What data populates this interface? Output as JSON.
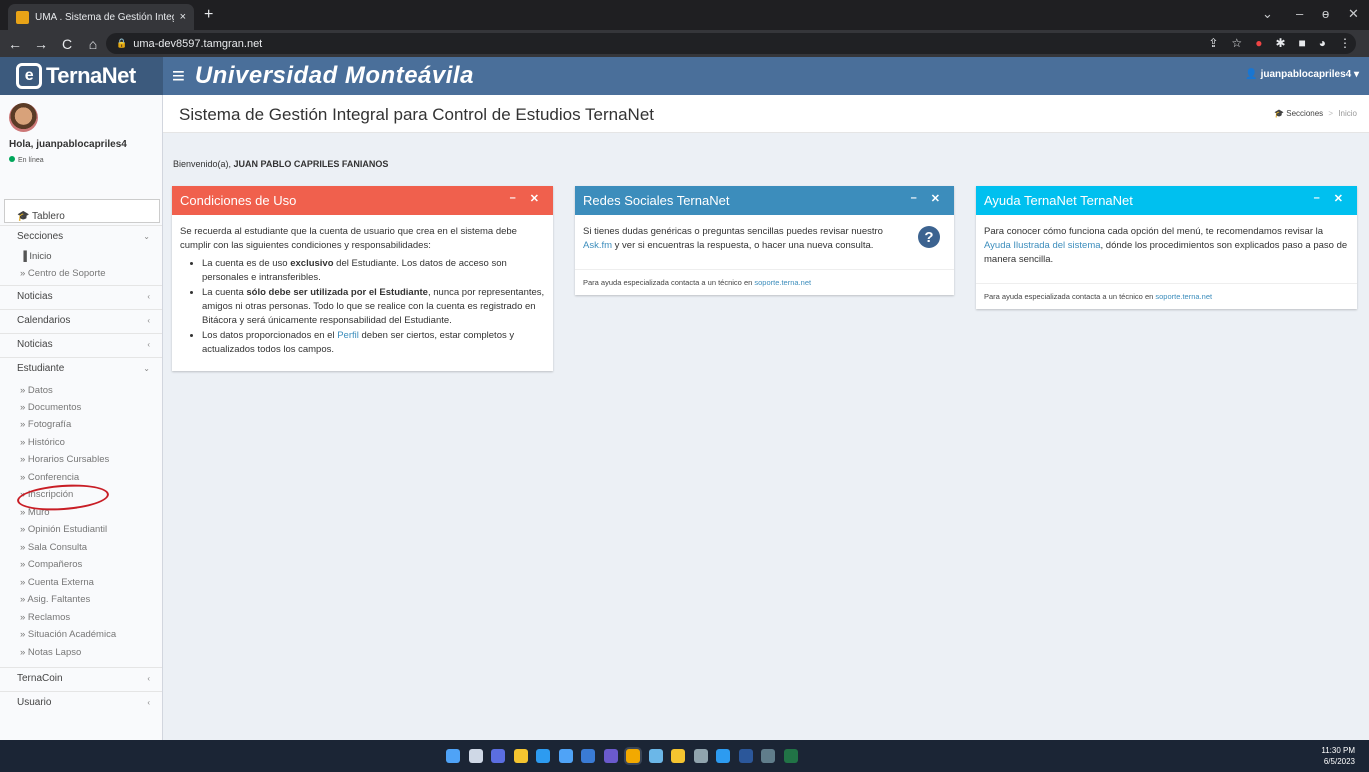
{
  "browser": {
    "tab_title": "UMA . Sistema de Gestión Integr",
    "tab_close": "×",
    "new_tab": "+",
    "url": "uma-dev8597.tamgran.net",
    "nav": {
      "back": "←",
      "forward": "→",
      "reload": "C",
      "home": "⌂"
    },
    "window_controls": {
      "dropdown": "⌄",
      "minimize": "–",
      "maximize": "ɵ",
      "close": "✕"
    },
    "icons": [
      "share-icon",
      "star-icon",
      "extension-icon",
      "puzzle-icon",
      "sidebar-icon",
      "profile-icon",
      "menu-icon"
    ]
  },
  "header": {
    "logo_text": "TernaNet",
    "hamburger": "≡",
    "university": "Universidad Monteávila",
    "user_menu": "👤 juanpablocapriles4 ▾"
  },
  "sidebar": {
    "greeting": "Hola, juanpablocapriles4",
    "status": "En línea",
    "search": {
      "value": "",
      "placeholder": ""
    },
    "tablero": "🎓 Tablero",
    "sections": {
      "secciones": "Secciones",
      "inicio": "▐ Inicio",
      "centro_soporte": "» Centro de Soporte",
      "noticias1": "Noticias",
      "calendarios": "Calendarios",
      "noticias2": "Noticias",
      "estudiante": "Estudiante",
      "ternacoin": "TernaCoin",
      "usuario": "Usuario"
    },
    "estudiante_items": [
      "» Datos",
      "» Documentos",
      "» Fotografía",
      "» Histórico",
      "» Horarios Cursables",
      "» Conferencia",
      "» Inscripción",
      "» Muro",
      "» Opinión Estudiantil",
      "» Sala Consulta",
      "» Compañeros",
      "» Cuenta Externa",
      "» Asig. Faltantes",
      "» Reclamos",
      "» Situación Académica",
      "» Notas Lapso"
    ]
  },
  "content": {
    "page_title": "Sistema de Gestión Integral para Control de Estudios TernaNet",
    "breadcrumb": {
      "icon": "🎓",
      "secciones": "Secciones",
      "sep": ">",
      "inicio": "Inicio"
    },
    "welcome_prefix": "Bienvenido(a), ",
    "welcome_name": "JUAN PABLO CAPRILES FANIANOS",
    "boxes": {
      "condiciones": {
        "title": "Condiciones de Uso",
        "color": "#f0604d",
        "intro": "Se recuerda al estudiante que la cuenta de usuario que crea en el sistema debe cumplir con las siguientes condiciones y responsabilidades:",
        "b1_pre": "La cuenta es de uso ",
        "b1_bold": "exclusivo",
        "b1_post": " del Estudiante. Los datos de acceso son personales e intransferibles.",
        "b2_pre": "La cuenta ",
        "b2_bold": "sólo debe ser utilizada por el Estudiante",
        "b2_post": ", nunca por representantes, amigos ni otras personas. Todo lo que se realice con la cuenta es registrado en Bitácora y será únicamente responsabilidad del Estudiante.",
        "b3_pre": "Los datos proporcionados en el ",
        "b3_link": "Perfil",
        "b3_post": " deben ser ciertos, estar completos y actualizados todos los campos."
      },
      "redes": {
        "title": "Redes Sociales TernaNet",
        "color": "#3c8dbc",
        "text_pre": "Si tienes dudas genéricas o preguntas sencillas puedes revisar nuestro ",
        "link": "Ask.fm",
        "text_post": " y ver si encuentras la respuesta, o hacer una nueva consulta.",
        "help_glyph": "?",
        "footer_pre": "Para ayuda especializada contacta a un técnico en ",
        "footer_link": "soporte.terna.net"
      },
      "ayuda": {
        "title": "Ayuda TernaNet TernaNet",
        "color": "#00c0ef",
        "text_pre": "Para conocer cómo funciona cada opción del menú, te recomendamos revisar la ",
        "link": "Ayuda Ilustrada del sistema",
        "text_post": ", dónde los procedimientos son explicados paso a paso de manera sencilla.",
        "footer_pre": "Para ayuda especializada contacta a un técnico en ",
        "footer_link": "soporte.terna.net"
      },
      "tools": {
        "minimize": "–",
        "close": "✕"
      }
    }
  },
  "taskbar": {
    "time": "11:30 PM",
    "date": "6/5/2023",
    "apps": [
      "windows-icon",
      "taskview-icon",
      "chat-icon",
      "explorer-icon",
      "edge-icon",
      "store-icon",
      "app-icon",
      "app-icon",
      "chrome-icon",
      "app-icon",
      "app-icon",
      "app-icon",
      "app-icon",
      "word-icon",
      "app-icon",
      "excel-icon"
    ],
    "app_colors": [
      "#4fa3f7",
      "#cfd8e6",
      "#5b6ee1",
      "#f4c430",
      "#2d9bf0",
      "#4fa3f7",
      "#3a7bd5",
      "#6a5acd",
      "#f2a900",
      "#6bb7e8",
      "#f4c430",
      "#90a4ae",
      "#2d9bf0",
      "#2b579a",
      "#607d8b",
      "#217346"
    ]
  }
}
